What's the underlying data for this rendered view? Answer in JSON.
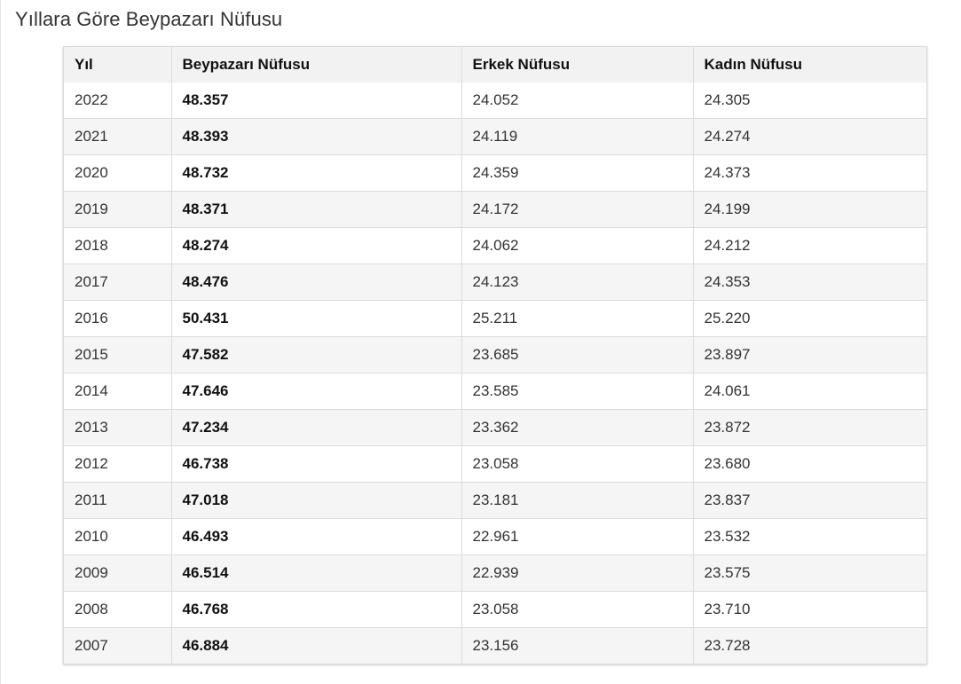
{
  "page": {
    "title": "Yıllara Göre Beypazarı Nüfusu"
  },
  "table": {
    "headers": [
      "Yıl",
      "Beypazarı Nüfusu",
      "Erkek Nüfusu",
      "Kadın Nüfusu"
    ],
    "rows": [
      [
        "2022",
        "48.357",
        "24.052",
        "24.305"
      ],
      [
        "2021",
        "48.393",
        "24.119",
        "24.274"
      ],
      [
        "2020",
        "48.732",
        "24.359",
        "24.373"
      ],
      [
        "2019",
        "48.371",
        "24.172",
        "24.199"
      ],
      [
        "2018",
        "48.274",
        "24.062",
        "24.212"
      ],
      [
        "2017",
        "48.476",
        "24.123",
        "24.353"
      ],
      [
        "2016",
        "50.431",
        "25.211",
        "25.220"
      ],
      [
        "2015",
        "47.582",
        "23.685",
        "23.897"
      ],
      [
        "2014",
        "47.646",
        "23.585",
        "24.061"
      ],
      [
        "2013",
        "47.234",
        "23.362",
        "23.872"
      ],
      [
        "2012",
        "46.738",
        "23.058",
        "23.680"
      ],
      [
        "2011",
        "47.018",
        "23.181",
        "23.837"
      ],
      [
        "2010",
        "46.493",
        "22.961",
        "23.532"
      ],
      [
        "2009",
        "46.514",
        "22.939",
        "23.575"
      ],
      [
        "2008",
        "46.768",
        "23.058",
        "23.710"
      ],
      [
        "2007",
        "46.884",
        "23.156",
        "23.728"
      ]
    ]
  }
}
